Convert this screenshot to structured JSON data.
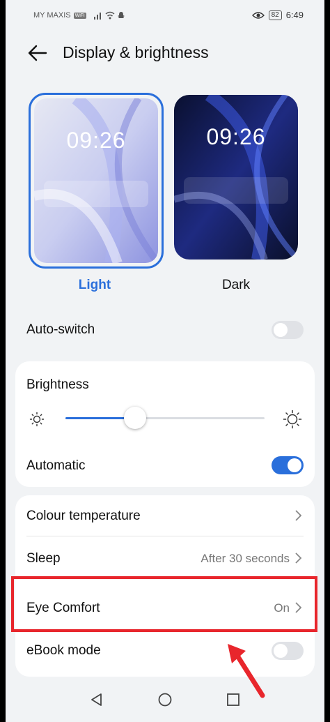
{
  "status_bar": {
    "carrier": "MY MAXIS",
    "wifi_badge": "WiFi",
    "battery": "82",
    "time": "6:49"
  },
  "header": {
    "title": "Display & brightness"
  },
  "themes": {
    "light": {
      "time": "09:26",
      "label": "Light",
      "selected": true
    },
    "dark": {
      "time": "09:26",
      "label": "Dark",
      "selected": false
    }
  },
  "auto_switch": {
    "label": "Auto-switch",
    "enabled": false
  },
  "brightness": {
    "label": "Brightness",
    "level": 0.35
  },
  "automatic": {
    "label": "Automatic",
    "enabled": true
  },
  "colour_temperature": {
    "label": "Colour temperature"
  },
  "sleep": {
    "label": "Sleep",
    "value": "After 30 seconds"
  },
  "eye_comfort": {
    "label": "Eye Comfort",
    "value": "On"
  },
  "ebook_mode": {
    "label": "eBook mode",
    "enabled": false
  },
  "colors": {
    "accent": "#2a6fdb",
    "highlight": "#e8262c"
  }
}
